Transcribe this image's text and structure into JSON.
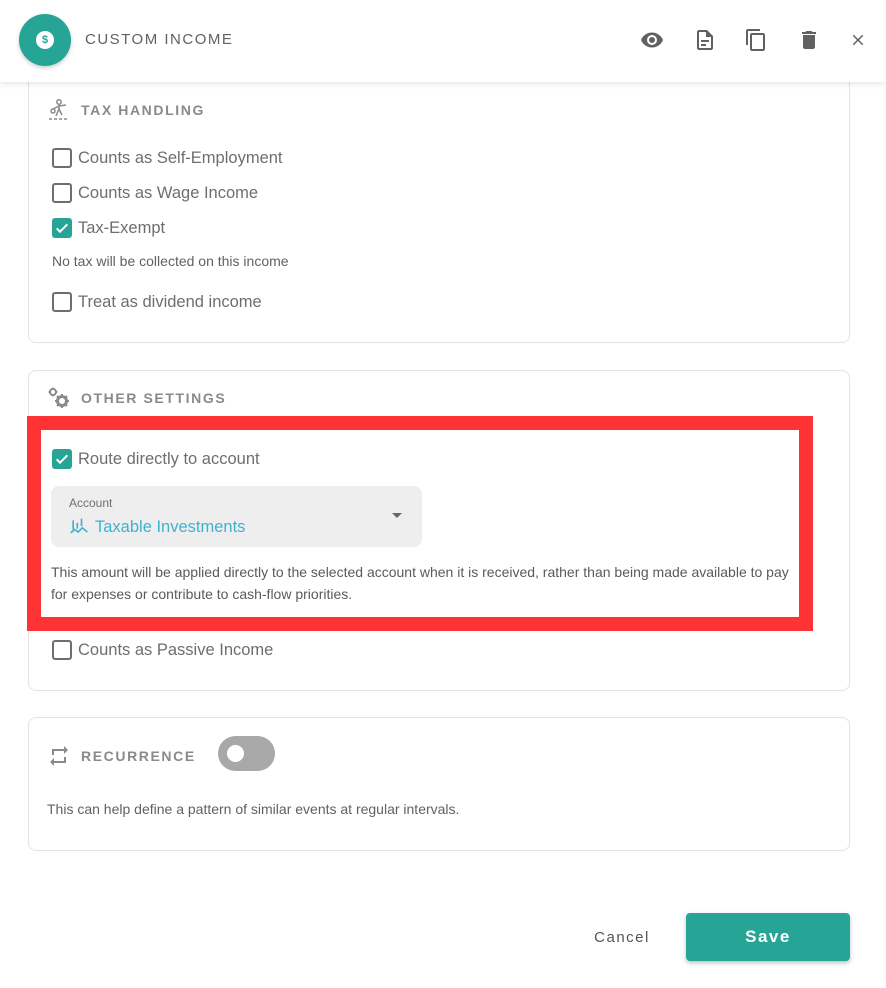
{
  "header": {
    "title": "CUSTOM INCOME",
    "avatar_icon": "dollar-coin-icon",
    "avatar_symbol": "$",
    "actions": [
      {
        "name": "preview",
        "icon": "eye-icon"
      },
      {
        "name": "notes",
        "icon": "document-icon"
      },
      {
        "name": "duplicate",
        "icon": "copy-icon"
      },
      {
        "name": "delete",
        "icon": "trash-icon"
      },
      {
        "name": "close",
        "icon": "close-icon"
      }
    ]
  },
  "tax_handling": {
    "title": "TAX HANDLING",
    "icon": "tax-scale-icon",
    "options": [
      {
        "label": "Counts as Self-Employment",
        "checked": false
      },
      {
        "label": "Counts as Wage Income",
        "checked": false
      },
      {
        "label": "Tax-Exempt",
        "checked": true
      },
      {
        "label": "Treat as dividend income",
        "checked": false
      }
    ],
    "tax_exempt_hint": "No tax will be collected on this income"
  },
  "other_settings": {
    "title": "OTHER SETTINGS",
    "icon": "gears-icon",
    "route_directly": {
      "label": "Route directly to account",
      "checked": true
    },
    "account_select": {
      "label": "Account",
      "value": "Taxable Investments",
      "value_icon": "investments-chart-icon"
    },
    "route_description": "This amount will be applied directly to the selected account when it is received, rather than being made available to pay for expenses or contribute to cash-flow priorities.",
    "passive_income": {
      "label": "Counts as Passive Income",
      "checked": false
    }
  },
  "recurrence": {
    "title": "RECURRENCE",
    "icon": "repeat-icon",
    "enabled": false,
    "description": "This can help define a pattern of similar events at regular intervals."
  },
  "footer": {
    "cancel_label": "Cancel",
    "save_label": "Save"
  },
  "colors": {
    "accent": "#26a596",
    "account_link": "#3fb2cf",
    "highlight": "#ff3333"
  }
}
